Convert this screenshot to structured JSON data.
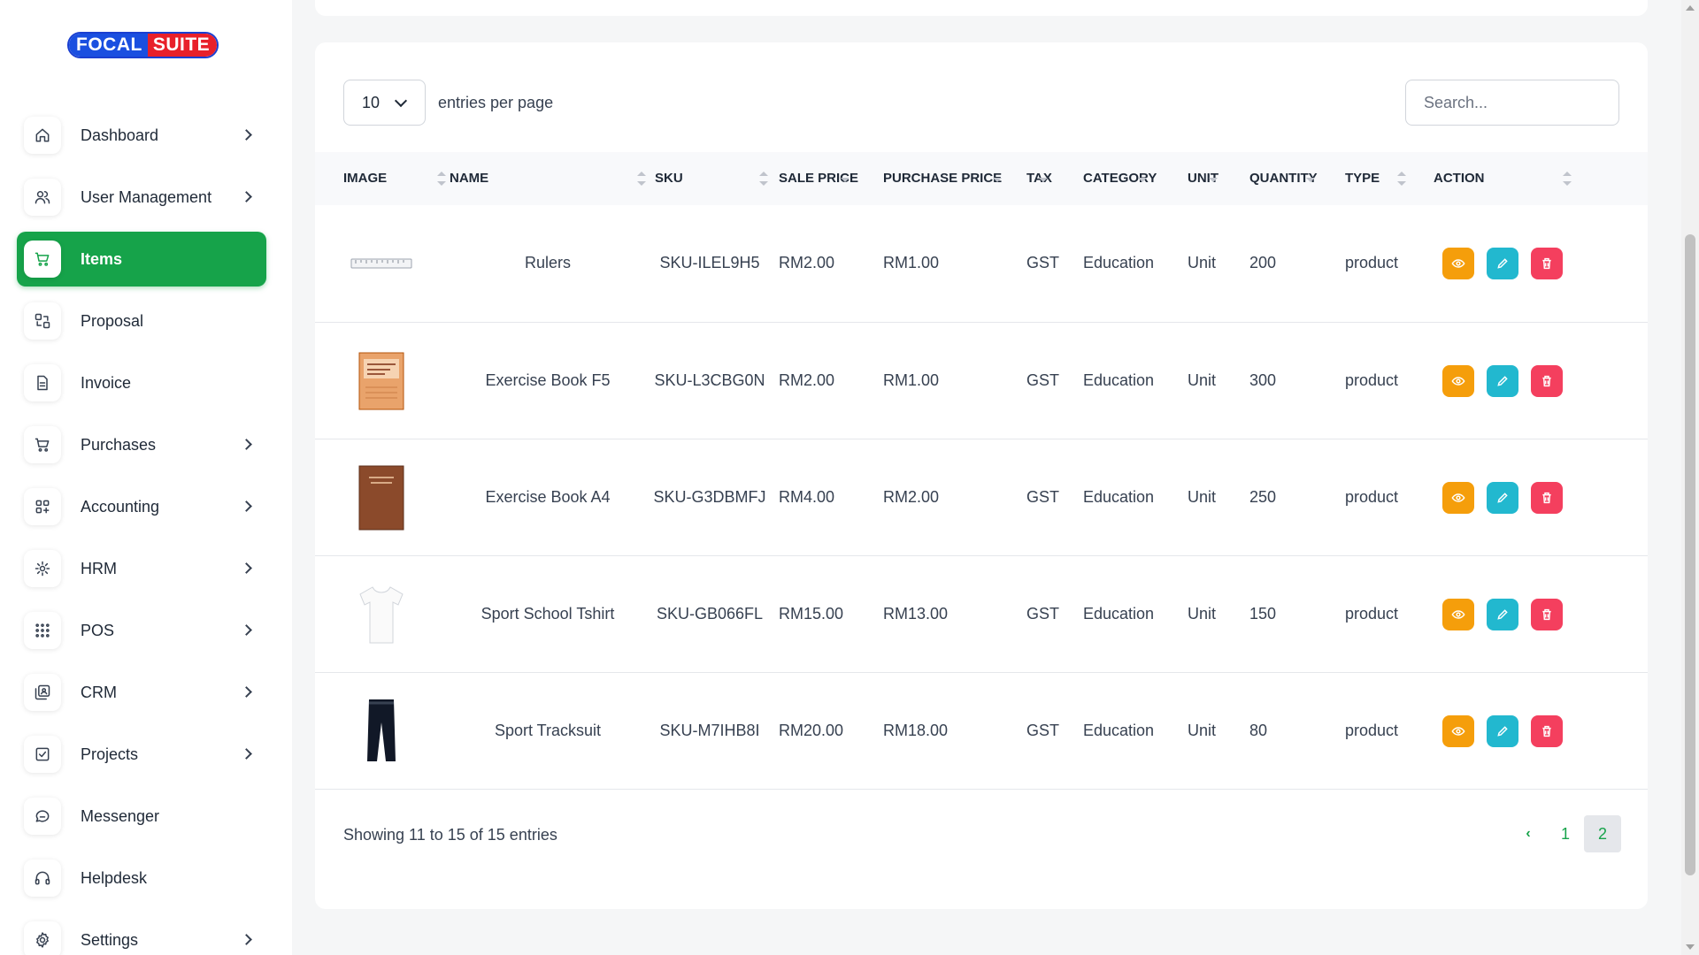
{
  "brand": {
    "part1": "FOCAL",
    "part2": "SUITE"
  },
  "sidebar": {
    "items": [
      {
        "label": "Dashboard",
        "icon": "home-icon",
        "chevron": true
      },
      {
        "label": "User Management",
        "icon": "users-icon",
        "chevron": true
      },
      {
        "label": "Items",
        "icon": "cart-icon",
        "chevron": false,
        "active": true
      },
      {
        "label": "Proposal",
        "icon": "proposal-icon",
        "chevron": false
      },
      {
        "label": "Invoice",
        "icon": "file-icon",
        "chevron": false
      },
      {
        "label": "Purchases",
        "icon": "cart-icon",
        "chevron": true
      },
      {
        "label": "Accounting",
        "icon": "grid-icon",
        "chevron": true
      },
      {
        "label": "HRM",
        "icon": "hrm-icon",
        "chevron": true
      },
      {
        "label": "POS",
        "icon": "dots-grid-icon",
        "chevron": true
      },
      {
        "label": "CRM",
        "icon": "crm-icon",
        "chevron": true
      },
      {
        "label": "Projects",
        "icon": "checkbox-icon",
        "chevron": true
      },
      {
        "label": "Messenger",
        "icon": "chat-icon",
        "chevron": false
      },
      {
        "label": "Helpdesk",
        "icon": "headset-icon",
        "chevron": false
      },
      {
        "label": "Settings",
        "icon": "gear-icon",
        "chevron": true
      }
    ]
  },
  "table_controls": {
    "per_page_value": "10",
    "per_page_label": "entries per page",
    "search_placeholder": "Search..."
  },
  "table": {
    "headers": [
      "IMAGE",
      "NAME",
      "SKU",
      "SALE PRICE",
      "PURCHASE PRICE",
      "TAX",
      "CATEGORY",
      "UNIT",
      "QUANTITY",
      "TYPE",
      "ACTION"
    ],
    "rows": [
      {
        "image": "ruler",
        "name": "Rulers",
        "sku": "SKU-ILEL9H5",
        "sale_price": "RM2.00",
        "purchase_price": "RM1.00",
        "tax": "GST",
        "category": "Education",
        "unit": "Unit",
        "quantity": "200",
        "type": "product"
      },
      {
        "image": "exercise-book-f5",
        "name": "Exercise Book F5",
        "sku": "SKU-L3CBG0N",
        "sale_price": "RM2.00",
        "purchase_price": "RM1.00",
        "tax": "GST",
        "category": "Education",
        "unit": "Unit",
        "quantity": "300",
        "type": "product"
      },
      {
        "image": "exercise-book-a4",
        "name": "Exercise Book A4",
        "sku": "SKU-G3DBMFJ",
        "sale_price": "RM4.00",
        "purchase_price": "RM2.00",
        "tax": "GST",
        "category": "Education",
        "unit": "Unit",
        "quantity": "250",
        "type": "product"
      },
      {
        "image": "tshirt",
        "name": "Sport School Tshirt",
        "sku": "SKU-GB066FL",
        "sale_price": "RM15.00",
        "purchase_price": "RM13.00",
        "tax": "GST",
        "category": "Education",
        "unit": "Unit",
        "quantity": "150",
        "type": "product"
      },
      {
        "image": "tracksuit",
        "name": "Sport Tracksuit",
        "sku": "SKU-M7IHB8I",
        "sale_price": "RM20.00",
        "purchase_price": "RM18.00",
        "tax": "GST",
        "category": "Education",
        "unit": "Unit",
        "quantity": "80",
        "type": "product"
      }
    ]
  },
  "footer": {
    "showing": "Showing 11 to 15 of 15 entries",
    "pages": [
      "1",
      "2"
    ],
    "prev": "‹",
    "current_page": "2"
  },
  "colors": {
    "accent": "#16a34a",
    "view": "#f59e0b",
    "edit": "#22b8cf",
    "delete": "#f43f5e"
  }
}
